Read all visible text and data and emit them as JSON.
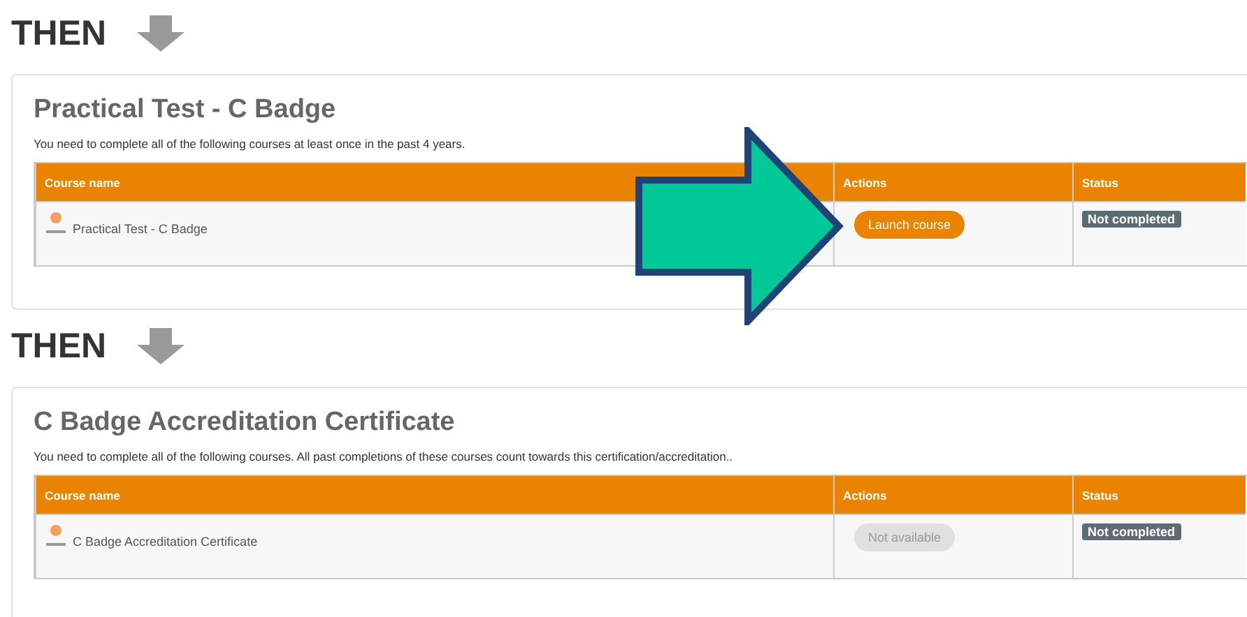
{
  "sections": [
    {
      "heading": "THEN",
      "title": "Practical Test - C Badge",
      "description": "You need to complete all of the following courses at least once in the past 4 years.",
      "columns": [
        "Course name",
        "Actions",
        "Status"
      ],
      "rows": [
        {
          "course": "Practical Test - C Badge",
          "action": {
            "label": "Launch course",
            "disabled": false
          },
          "status": "Not completed"
        }
      ]
    },
    {
      "heading": "THEN",
      "title": "C Badge Accreditation Certificate",
      "description": "You need to complete all of the following courses. All past completions of these courses count towards this certification/accreditation..",
      "columns": [
        "Course name",
        "Actions",
        "Status"
      ],
      "rows": [
        {
          "course": "C Badge Accreditation Certificate",
          "action": {
            "label": "Not available",
            "disabled": true
          },
          "status": "Not completed"
        }
      ]
    }
  ]
}
